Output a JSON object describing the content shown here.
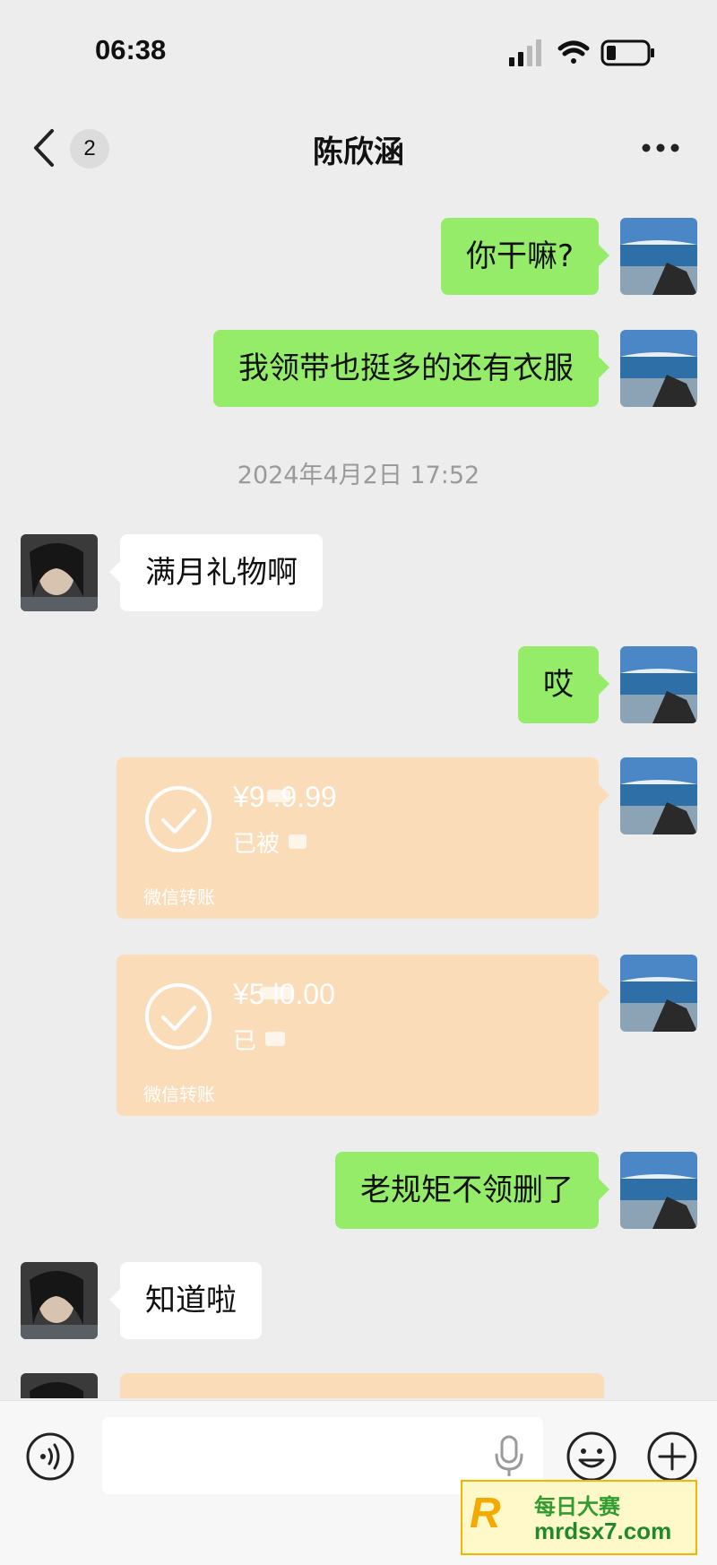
{
  "status": {
    "time": "06:38"
  },
  "header": {
    "unread_count": "2",
    "title": "陈欣涵"
  },
  "messages": [
    {
      "from": "me",
      "text": "你干嘛?"
    },
    {
      "from": "me",
      "text": "我领带也挺多的还有衣服"
    },
    {
      "timestamp": "2024年4月2日 17:52"
    },
    {
      "from": "other",
      "text": "满月礼物啊"
    },
    {
      "from": "me",
      "text": "哎"
    },
    {
      "from": "me",
      "type": "transfer",
      "amount": "¥9  .9.99",
      "status": "已被",
      "footer": "微信转账"
    },
    {
      "from": "me",
      "type": "transfer",
      "amount": "¥5   l0.00",
      "status": "已",
      "footer": "微信转账"
    },
    {
      "from": "me",
      "text": "老规矩不领删了"
    },
    {
      "from": "other",
      "text": "知道啦"
    }
  ],
  "watermark": {
    "top": "每日大赛",
    "bottom": "mrdsx7.com",
    "letter": "R"
  }
}
